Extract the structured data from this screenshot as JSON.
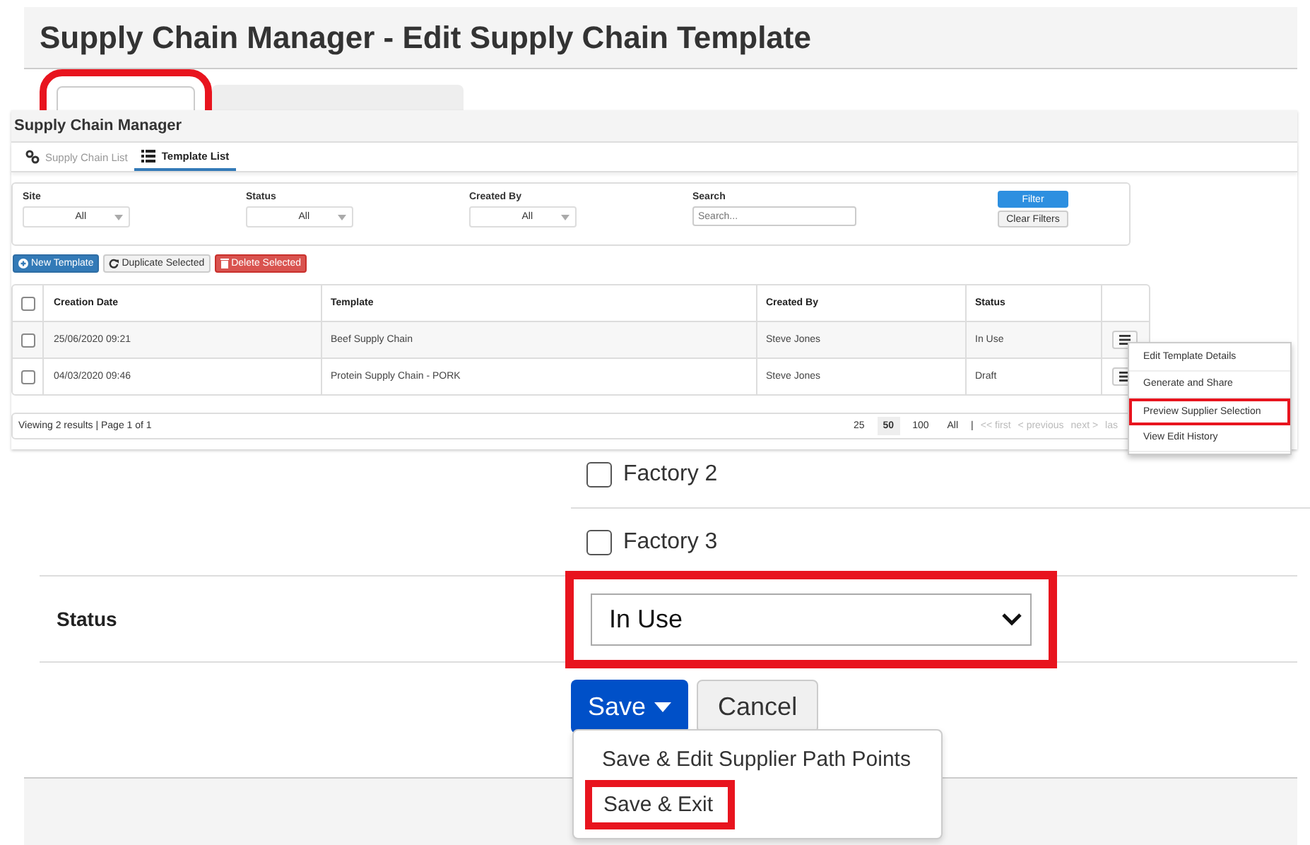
{
  "page": {
    "title": "Supply Chain Manager - Edit Supply Chain Template"
  },
  "tabs": [
    {
      "selected": true,
      "highlighted": true
    },
    {
      "selected": false,
      "highlighted": false
    }
  ],
  "inset": {
    "title": "Supply Chain Manager",
    "tabs": [
      {
        "label": "Supply Chain List",
        "selected": false
      },
      {
        "label": "Template List",
        "selected": true
      }
    ],
    "filters": [
      {
        "label": "Site",
        "value": "All"
      },
      {
        "label": "Status",
        "value": "All"
      },
      {
        "label": "Created By",
        "value": "All"
      }
    ],
    "search": {
      "label": "Search",
      "placeholder": "Search..."
    },
    "filter_button": "Filter",
    "clear_button": "Clear Filters",
    "actions": [
      {
        "label": "New Template",
        "kind": "primary"
      },
      {
        "label": "Duplicate Selected",
        "kind": "default"
      },
      {
        "label": "Delete Selected",
        "kind": "danger"
      }
    ],
    "table": {
      "header_checked": false,
      "columns": [
        "Creation Date",
        "Template",
        "Created By",
        "Status"
      ],
      "rows": [
        {
          "checked": false,
          "cells": [
            "25/06/2020 09:21",
            "Beef Supply Chain",
            "Steve Jones",
            "In Use"
          ]
        },
        {
          "checked": false,
          "cells": [
            "04/03/2020 09:46",
            "Protein Supply Chain - PORK",
            "Steve Jones",
            "Draft"
          ]
        }
      ]
    },
    "summary": "Viewing 2 results | Page 1 of 1",
    "page_sizes": [
      {
        "label": "25",
        "selected": false
      },
      {
        "label": "50",
        "selected": true
      },
      {
        "label": "100",
        "selected": false
      },
      {
        "label": "All",
        "selected": false
      }
    ],
    "separator": "|",
    "pager_links": [
      "<< first",
      "< previous",
      "next >",
      "las"
    ],
    "context_menu": [
      {
        "label": "Edit Template Details",
        "highlighted": false
      },
      {
        "label": "Generate and Share",
        "highlighted": false
      },
      {
        "label": "Preview Supplier Selection",
        "highlighted": true
      },
      {
        "label": "View Edit History",
        "highlighted": false
      }
    ]
  },
  "factories": [
    {
      "label": "Factory 2",
      "checked": false
    },
    {
      "label": "Factory 3",
      "checked": false
    }
  ],
  "status": {
    "label": "Status",
    "value": "In Use",
    "highlighted": true
  },
  "save_button": "Save",
  "cancel_button": "Cancel",
  "save_menu": [
    {
      "label": "Save & Edit Supplier Path Points",
      "highlighted": false
    },
    {
      "label": "Save & Exit",
      "highlighted": true
    }
  ]
}
